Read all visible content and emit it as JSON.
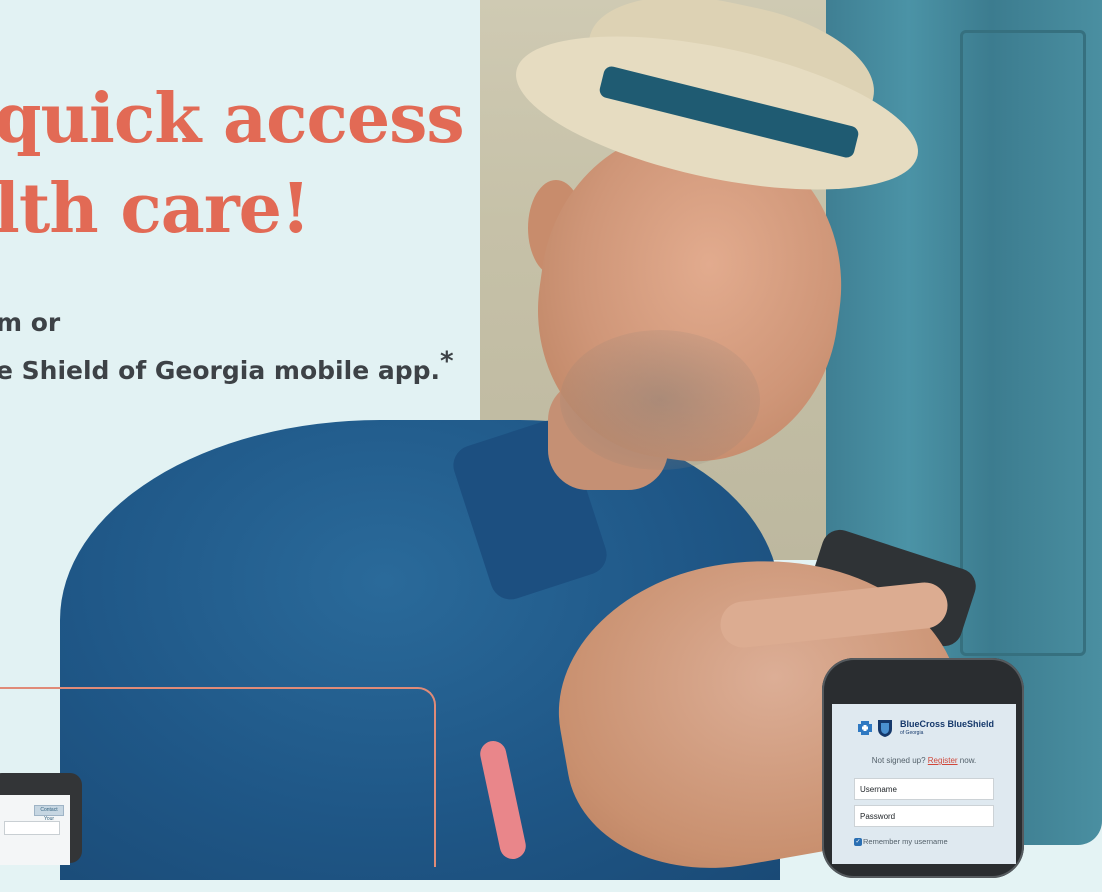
{
  "hero": {
    "headline_line1": "quick access",
    "headline_line2": "lth care!",
    "sub_line1": "m or",
    "sub_line2": "e Shield of Georgia mobile app.",
    "asterisk": "*"
  },
  "tablet": {
    "button_label": "Contact Your"
  },
  "phone": {
    "brand": "BlueCross BlueShield",
    "brand_sub": "of Georgia",
    "signup_prefix": "Not signed up? ",
    "register_link": "Register",
    "signup_suffix": " now.",
    "username_label": "Username",
    "password_label": "Password",
    "remember_label": "Remember my username"
  },
  "colors": {
    "headline": "#e26a55",
    "subtext": "#3d4246",
    "background": "#e2f2f3",
    "brand_blue": "#15386b",
    "link_red": "#d0473a"
  }
}
